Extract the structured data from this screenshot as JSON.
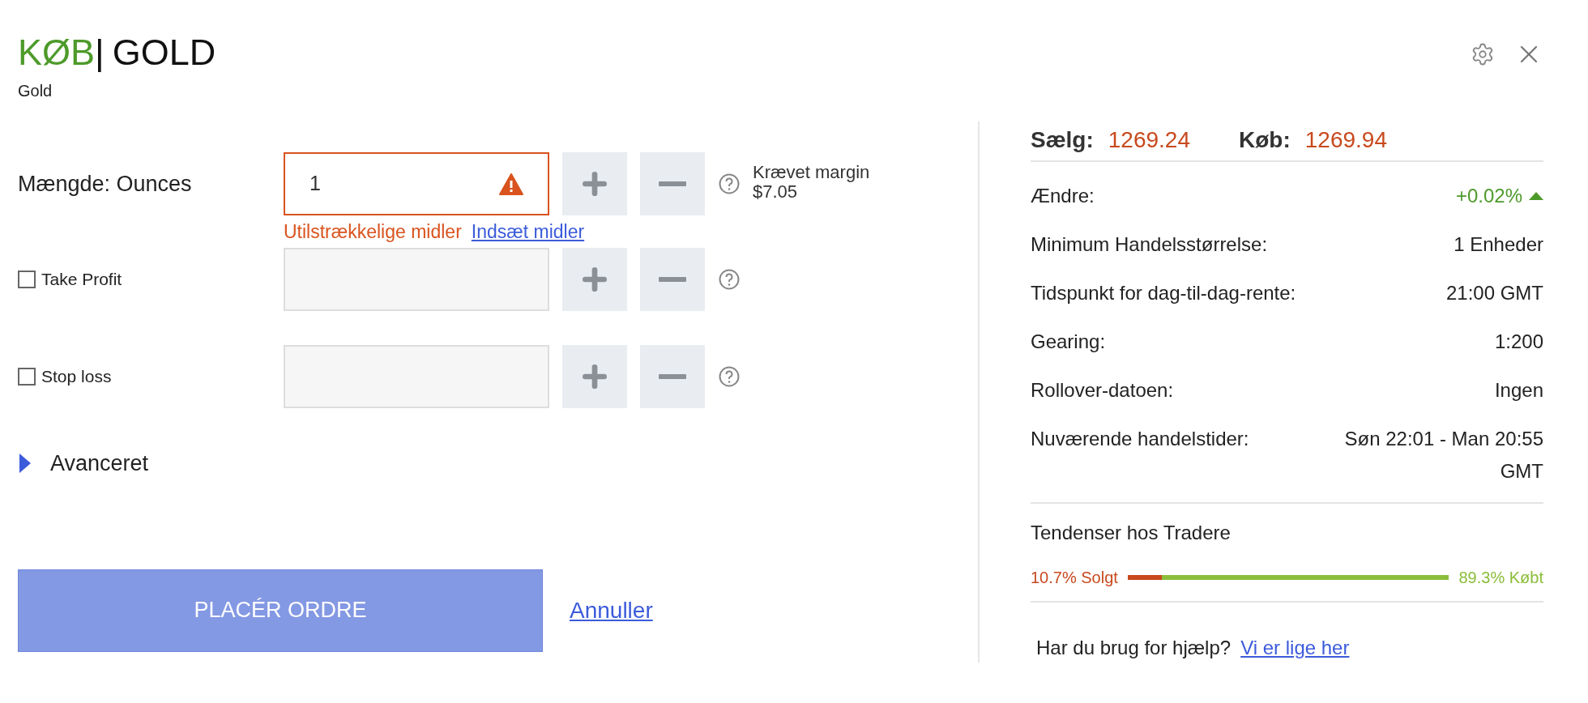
{
  "header": {
    "action": "KØB",
    "separator": "|",
    "instrument": "GOLD",
    "subtitle": "Gold"
  },
  "order_rows": [
    {
      "kind": "quantity",
      "label": "Mængde: Ounces",
      "value": "1",
      "error": true
    },
    {
      "kind": "checkbox",
      "label": "Take Profit",
      "checked": false
    },
    {
      "kind": "checkbox",
      "label": "Stop loss",
      "checked": false
    }
  ],
  "error": {
    "message": "Utilstrækkelige midler",
    "link": "Indsæt midler"
  },
  "margin": {
    "label": "Krævet margin",
    "value": "$7.05"
  },
  "advanced": {
    "label": "Avanceret",
    "expanded": false
  },
  "submit": {
    "label": "PLACÉR ORDRE",
    "disabled": true
  },
  "cancel": "Annuller",
  "prices": [
    {
      "label": "Sælg:",
      "value": "1269.24"
    },
    {
      "label": "Køb:",
      "value": "1269.94"
    }
  ],
  "details": [
    {
      "label": "Ændre:",
      "value": "+0.02%",
      "kind": "change",
      "up": true
    },
    {
      "label": "Minimum Handelsstørrelse:",
      "value": "1 Enheder"
    },
    {
      "label": "Tidspunkt for dag-til-dag-rente:",
      "value": "21:00 GMT"
    },
    {
      "label": "Gearing:",
      "value": "1:200"
    },
    {
      "label": "Rollover-datoen:",
      "value": "Ingen"
    },
    {
      "label": "Nuværende handelstider:",
      "value": "Søn 22:01 - Man 20:55 GMT"
    }
  ],
  "sentiment": {
    "title": "Tendenser hos Tradere",
    "sold": {
      "label": "10.7% Solgt",
      "level": 0.107
    },
    "bought": {
      "label": "89.3% Købt"
    }
  },
  "help": {
    "text": "Har du brug for hjælp?",
    "link": "Vi er lige her"
  }
}
